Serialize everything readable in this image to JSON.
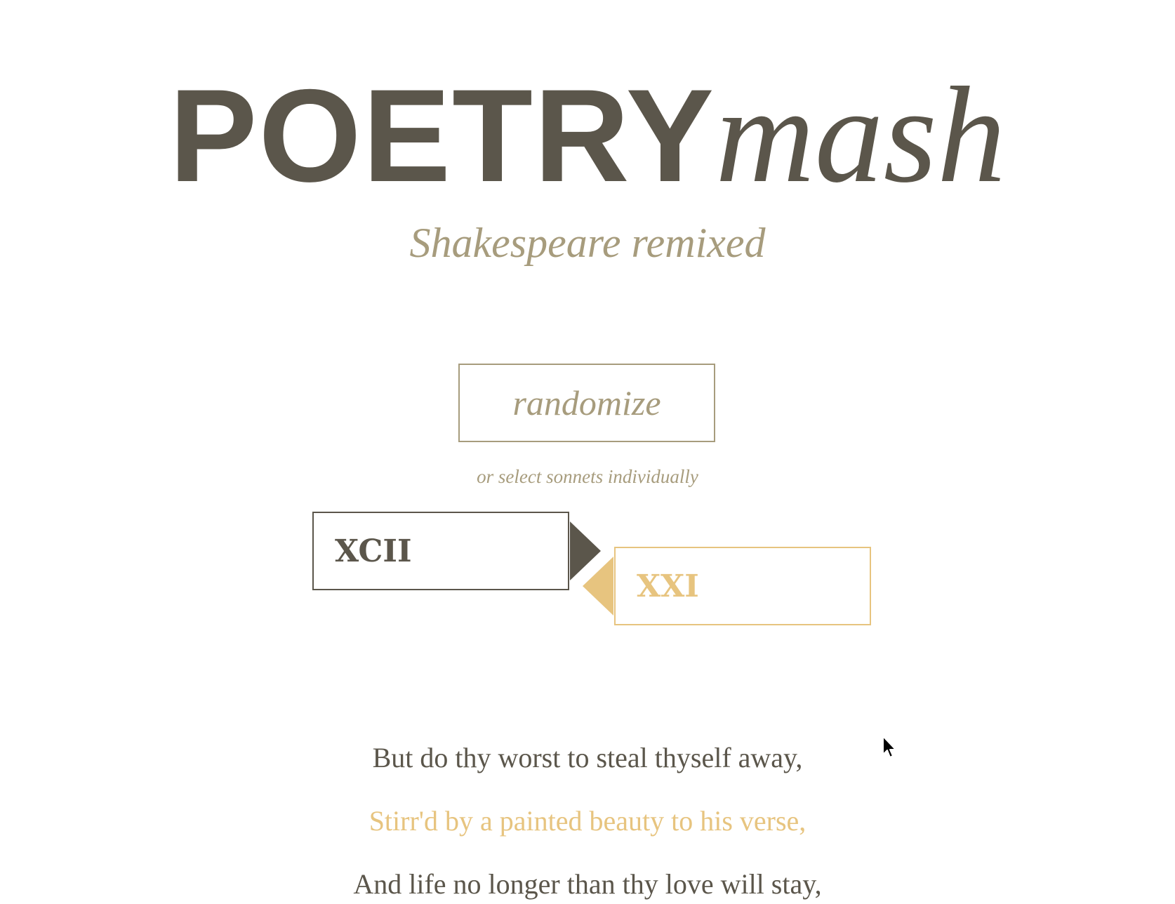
{
  "header": {
    "logo_bold": "POETRY",
    "logo_italic": "mash",
    "tagline": "Shakespeare remixed"
  },
  "controls": {
    "randomize_label": "randomize",
    "hint": "or select sonnets individually"
  },
  "sonnets": {
    "left": {
      "numeral": "XCII",
      "color": "#5b564b"
    },
    "right": {
      "numeral": "XXI",
      "color": "#e7c47f"
    }
  },
  "poem": {
    "lines": [
      {
        "text": "But do thy worst to steal thyself away,",
        "source": "left"
      },
      {
        "text": "Stirr'd by a painted beauty to his verse,",
        "source": "right"
      },
      {
        "text": "And life no longer than thy love will stay,",
        "source": "left"
      }
    ]
  },
  "colors": {
    "dark": "#5b564b",
    "muted": "#a79c7d",
    "gold": "#e7c47f",
    "background": "#ffffff"
  }
}
